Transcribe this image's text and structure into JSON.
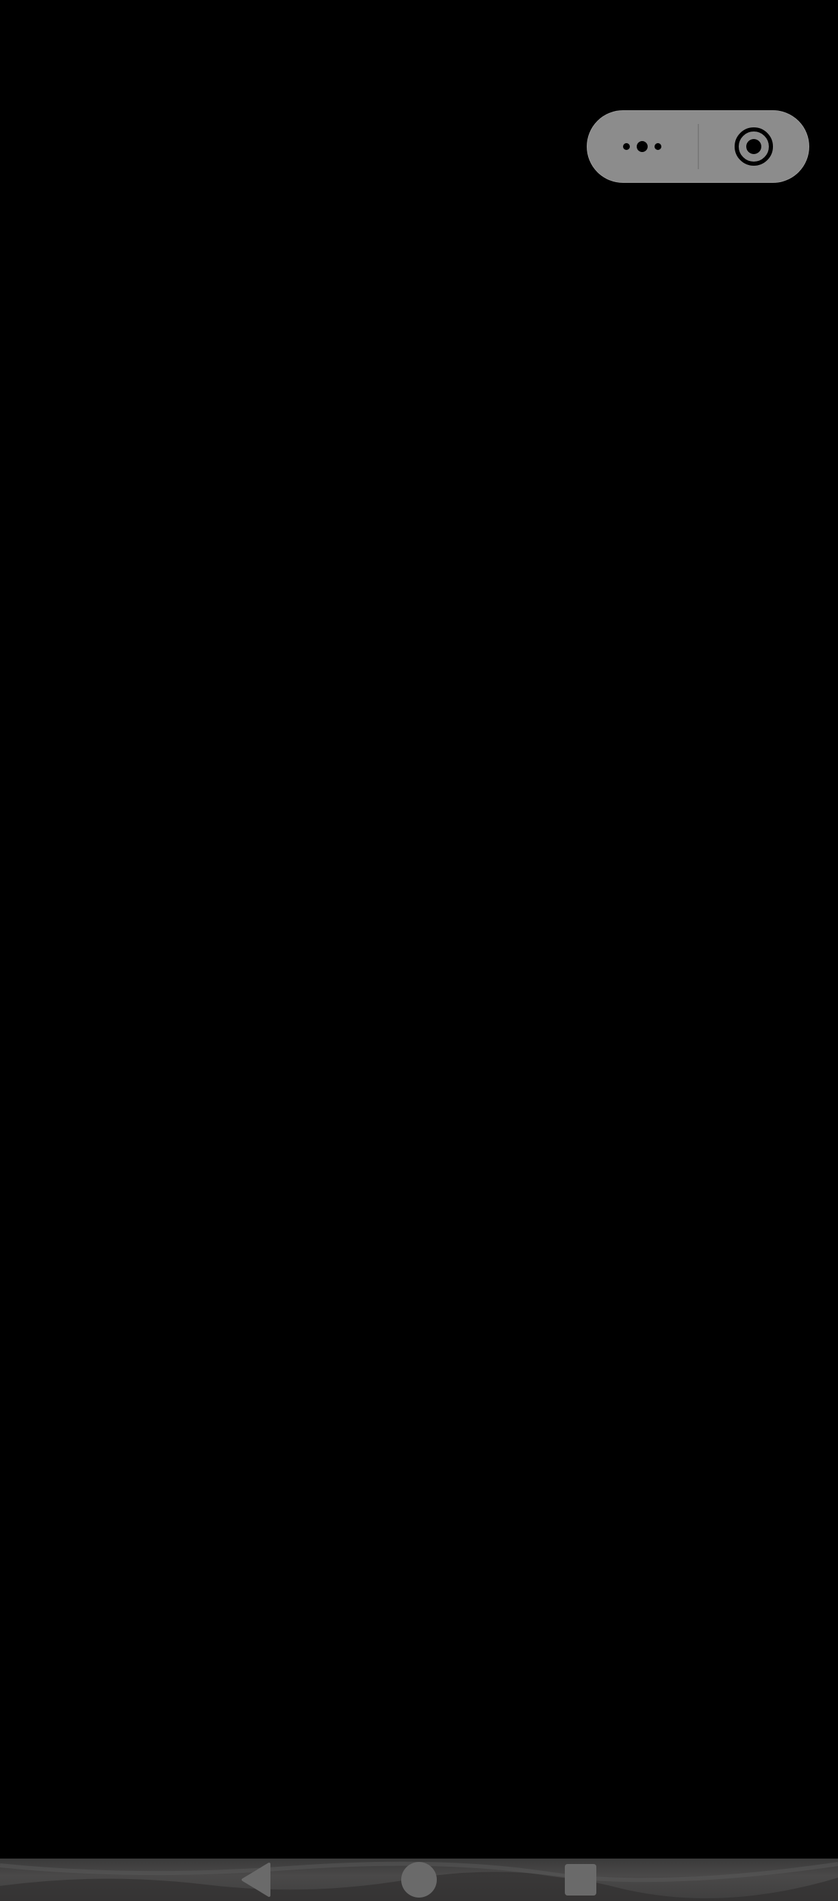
{
  "capsule": {
    "more_icon": "more-dots-icon",
    "close_icon": "target-close-icon",
    "background_color": "#8c8c8c",
    "icon_color": "#000000"
  },
  "navigation_bar": {
    "back_icon": "back-triangle-icon",
    "home_icon": "home-circle-icon",
    "recents_icon": "recents-square-icon",
    "icon_color": "#6a6a6a"
  },
  "screen": {
    "background_color": "#000000"
  }
}
